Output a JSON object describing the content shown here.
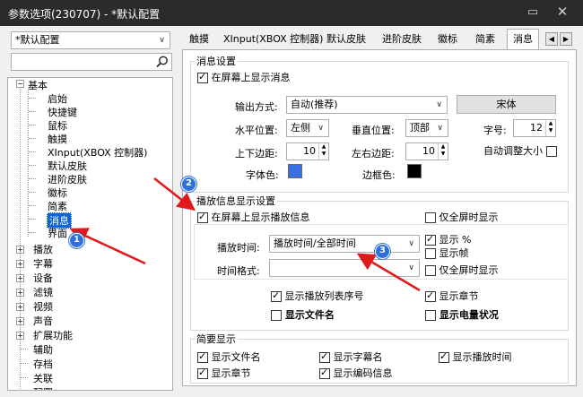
{
  "window": {
    "title": "参数选项(230707) - *默认配置",
    "minimize_icon": "minimize-icon",
    "close_icon": "close-icon"
  },
  "profile_select": {
    "value": "*默认配置"
  },
  "tree_search": {
    "value": "",
    "icon": "search-icon"
  },
  "tabs": [
    "触摸",
    "XInput(XBOX 控制器)",
    "默认皮肤",
    "进阶皮肤",
    "徽标",
    "简素",
    "消息"
  ],
  "active_tab": "消息",
  "tree": {
    "root_basic": "基本",
    "basic_children": [
      "启始",
      "快捷键",
      "鼠标",
      "触摸",
      "XInput(XBOX 控制器)",
      "默认皮肤",
      "进阶皮肤",
      "徽标",
      "简素",
      "消息",
      "界面"
    ],
    "selected": "消息",
    "collapsed": [
      "播放",
      "字幕",
      "设备",
      "滤镜",
      "视频",
      "声音",
      "扩展功能"
    ],
    "leaf": [
      "辅助",
      "存档",
      "关联",
      "配置"
    ]
  },
  "message_settings": {
    "group_title": "消息设置",
    "show_on_screen": "在屏幕上显示消息",
    "output_mode_label": "输出方式:",
    "output_mode_value": "自动(推荐)",
    "font_button": "宋体",
    "hpos_label": "水平位置:",
    "hpos_value": "左侧",
    "vpos_label": "垂直位置:",
    "vpos_value": "顶部",
    "fontsize_label": "字号:",
    "fontsize_value": "12",
    "top_bottom_margin_label": "上下边距:",
    "top_bottom_margin_value": "10",
    "left_right_margin_label": "左右边距:",
    "left_right_margin_value": "10",
    "auto_resize_label": "自动调整大小",
    "font_color_label": "字体色:",
    "font_color": "#3a6fe0",
    "border_color_label": "边框色:",
    "border_color": "#000000"
  },
  "playback_info": {
    "group_title": "播放信息显示设置",
    "show_on_screen": "在屏幕上显示播放信息",
    "fullscreen_only_1": "仅全屏时显示",
    "play_time_label": "播放时间:",
    "play_time_value": "播放时间/全部时间",
    "show_percent": "显示 %",
    "show_frames": "显示帧",
    "time_format_label": "时间格式:",
    "time_format_value": "",
    "fullscreen_only_2": "仅全屏时显示",
    "show_playlist_no": "显示播放列表序号",
    "show_chapter": "显示章节",
    "show_filename": "显示文件名",
    "show_battery": "显示电量状况"
  },
  "summary": {
    "group_title": "简要显示",
    "items": [
      "显示文件名",
      "显示字幕名",
      "显示播放时间",
      "显示章节",
      "显示编码信息"
    ]
  },
  "annotations": {
    "m1": "1",
    "m2": "2",
    "m3": "3"
  },
  "accent_colors": {
    "annotation_arrow": "#e0191c",
    "annotation_marker": "#2f6fdb",
    "selection": "#0a64d8"
  }
}
